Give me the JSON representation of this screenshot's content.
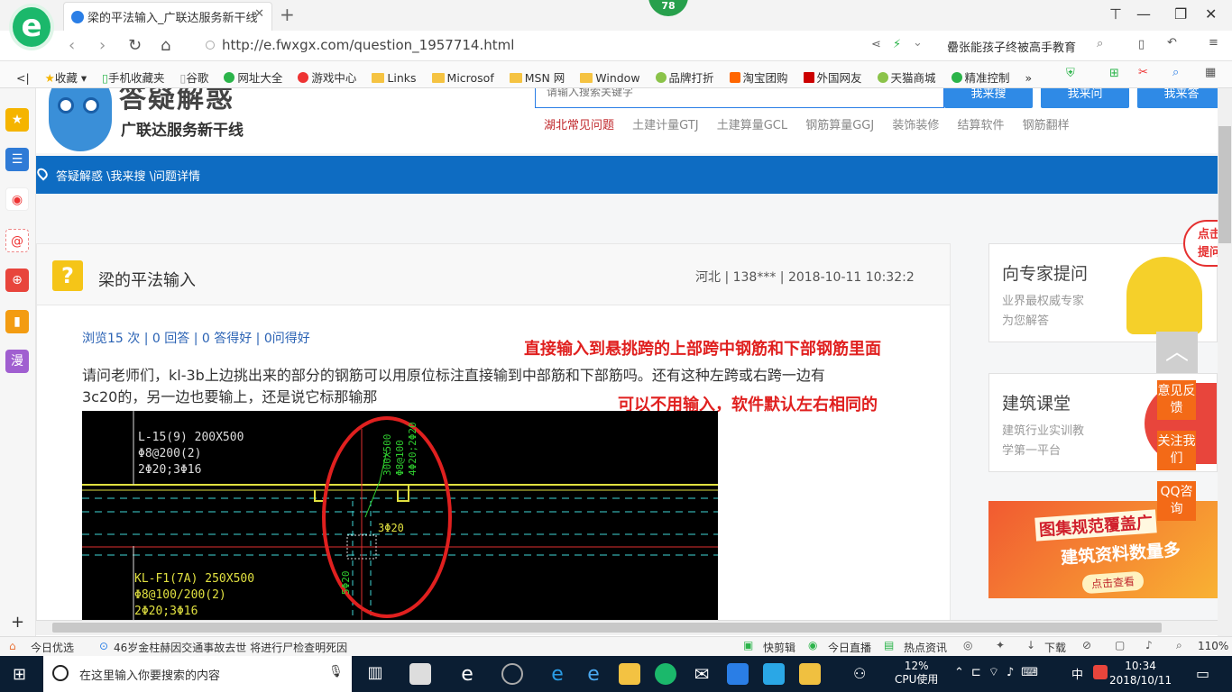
{
  "browser": {
    "tab_title": "梁的平法输入_广联达服务新干线",
    "badge": "78",
    "url": "http://e.fwxgx.com/question_1957714.html",
    "news_headline": "罍张能孩子终被高手教育"
  },
  "bookmarks": [
    "收藏",
    "手机收藏夹",
    "谷歌",
    "网址大全",
    "游戏中心",
    "Links",
    "Microsof",
    "MSN 网",
    "Window",
    "品牌打折",
    "淘宝团购",
    "外国网友",
    "天猫商城",
    "精准控制"
  ],
  "site": {
    "title": "答疑解惑",
    "subtitle": "广联达服务新干线",
    "search_placeholder": "请输入搜索关键字",
    "buttons": [
      "我来搜",
      "我来问",
      "我来答"
    ],
    "categories": [
      "湖北常见问题",
      "土建计量GTJ",
      "土建算量GCL",
      "钢筋算量GGJ",
      "装饰装修",
      "结算软件",
      "钢筋翻样"
    ],
    "breadcrumb": "答疑解惑 \\我来搜 \\问题详情"
  },
  "question": {
    "title": "梁的平法输入",
    "meta": "河北 | 138*** | 2018-10-11 10:32:2",
    "stats": "浏览15 次 | 0 回答 | 0 答得好 | 0问得好",
    "body_line1": "请问老师们，kl-3b上边挑出来的部分的钢筋可以用原位标注直接输到中部筋和下部筋吗。还有这种左跨或右跨一边有",
    "body_line2": "3c20的，另一边也要输上，还是说它标那输那",
    "annotation1": "直接输入到悬挑跨的上部跨中钢筋和下部钢筋里面",
    "annotation2": "可以不用输入，软件默认左右相同的",
    "cad": {
      "beam1": [
        "L-15(9) 200X500",
        "Φ8@200(2)",
        "2Φ20;3Φ16"
      ],
      "beam2": [
        "KL-F1(7A) 250X500",
        "Φ8@100/200(2)",
        "2Φ20;3Φ16"
      ],
      "green_vertical": [
        "300X500",
        "Φ8@100",
        "4Φ20;2Φ20"
      ],
      "green_label": "3Φ20",
      "green_small": "5Φ20"
    }
  },
  "sidebar_right": {
    "expert_title": "向专家提问",
    "expert_sub1": "业界最权威专家",
    "expert_sub2": "为您解答",
    "course_title": "建筑课堂",
    "course_sub1": "建筑行业实训教",
    "course_sub2": "学第一平台",
    "banner_line1": "图集规范覆盖广",
    "banner_line2": "建筑资料数量多",
    "banner_btn": "点击查看",
    "float_tab": "点击提问",
    "float_buttons": [
      "意见反馈",
      "关注我们",
      "QQ咨询"
    ]
  },
  "statusbar": {
    "left1": "今日优选",
    "news": "46岁金柱赫因交通事故去世 将进行尸检查明死因",
    "items": [
      "快剪辑",
      "今日直播",
      "热点资讯",
      "下载"
    ],
    "zoom": "110%"
  },
  "taskbar": {
    "search_placeholder": "在这里输入你要搜索的内容",
    "cpu_value": "12%",
    "cpu_label": "CPU使用",
    "ime": "中",
    "time": "10:34",
    "date": "2018/10/11"
  }
}
